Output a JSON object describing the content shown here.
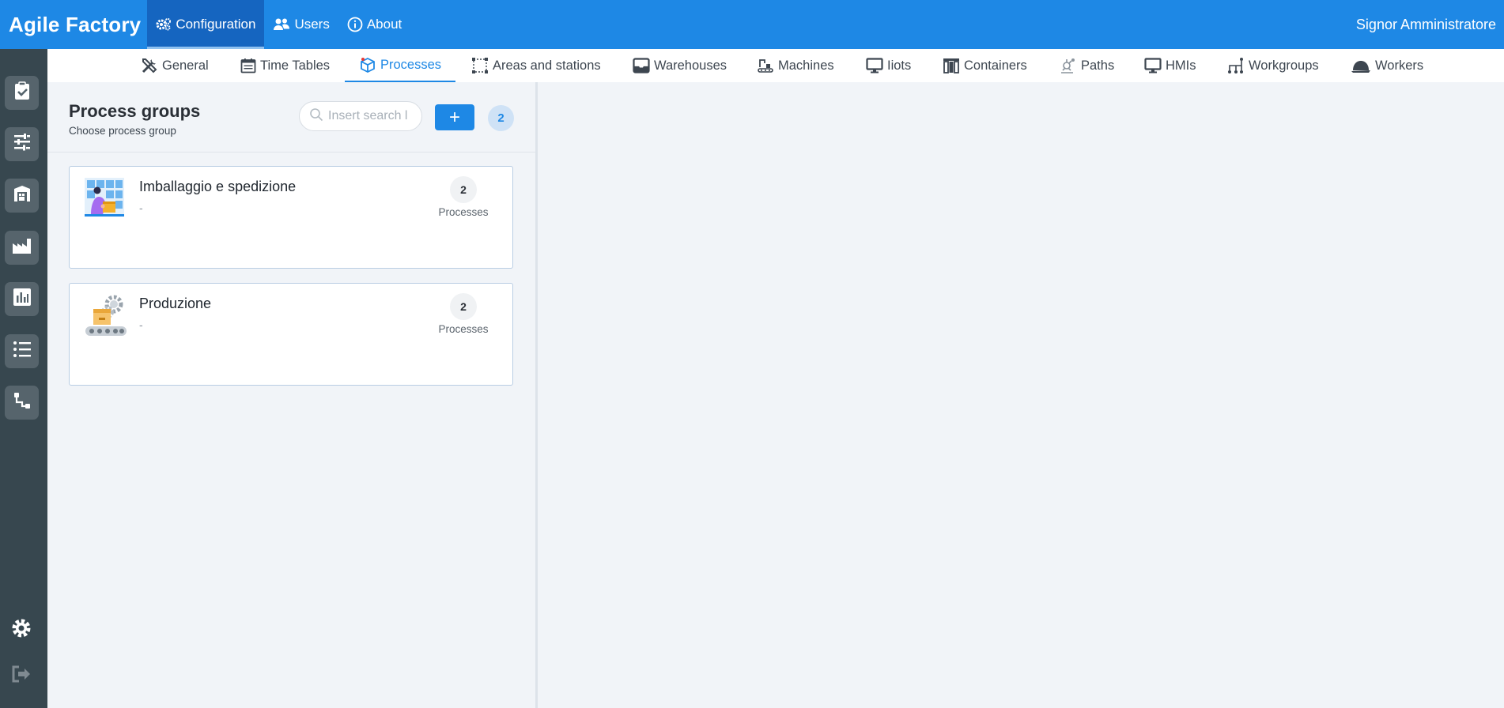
{
  "app": {
    "title": "Agile Factory"
  },
  "topnav": [
    {
      "label": "Configuration",
      "icon": "gears-icon",
      "active": true
    },
    {
      "label": "Users",
      "icon": "users-icon",
      "active": false
    },
    {
      "label": "About",
      "icon": "info-icon",
      "active": false
    }
  ],
  "user": {
    "name": "Signor Amministratore"
  },
  "subnav": [
    {
      "label": "General",
      "icon": "tools-icon"
    },
    {
      "label": "Time Tables",
      "icon": "calendar-icon"
    },
    {
      "label": "Processes",
      "icon": "cube-icon",
      "active": true
    },
    {
      "label": "Areas and stations",
      "icon": "area-icon"
    },
    {
      "label": "Warehouses",
      "icon": "inbox-icon"
    },
    {
      "label": "Machines",
      "icon": "machine-icon"
    },
    {
      "label": "Iiots",
      "icon": "monitor-icon"
    },
    {
      "label": "Containers",
      "icon": "containers-icon"
    },
    {
      "label": "Paths",
      "icon": "path-icon"
    },
    {
      "label": "HMIs",
      "icon": "monitor-icon"
    },
    {
      "label": "Workgroups",
      "icon": "workgroup-icon"
    },
    {
      "label": "Workers",
      "icon": "helmet-icon"
    }
  ],
  "sidebar": [
    {
      "icon": "clipboard-check-icon"
    },
    {
      "icon": "sliders-icon"
    },
    {
      "icon": "warehouse-icon"
    },
    {
      "icon": "factory-icon"
    },
    {
      "icon": "bar-chart-icon"
    },
    {
      "icon": "list-icon"
    },
    {
      "icon": "flow-icon"
    },
    {
      "icon": "settings-icon"
    },
    {
      "icon": "logout-icon"
    }
  ],
  "panel": {
    "title": "Process groups",
    "subtitle": "Choose process group",
    "search_placeholder": "Insert search l",
    "add_label": "+",
    "count": "2"
  },
  "groups": [
    {
      "name": "Imballaggio e spedizione",
      "description": "-",
      "count": "2",
      "count_label": "Processes",
      "thumb": "packing-worker-illustration"
    },
    {
      "name": "Produzione",
      "description": "-",
      "count": "2",
      "count_label": "Processes",
      "thumb": "production-conveyor-illustration"
    }
  ],
  "colors": {
    "primary": "#1e88e5",
    "primary_dark": "#1565c0",
    "sidebar": "#37474f"
  }
}
